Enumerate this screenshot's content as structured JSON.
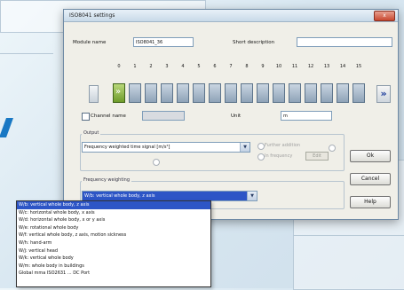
{
  "window": {
    "title": "ISO8041 settings",
    "close_symbol": "x"
  },
  "module": {
    "name_label": "Module name",
    "name_value": "ISO8041_36",
    "short_desc_label": "Short description",
    "short_desc_value": ""
  },
  "channels": {
    "numbers": [
      "0",
      "1",
      "2",
      "3",
      "4",
      "5",
      "6",
      "7",
      "8",
      "9",
      "10",
      "11",
      "12",
      "13",
      "14",
      "15"
    ],
    "active_index": 0,
    "nav_last_symbol": "»"
  },
  "channel_name": {
    "label": "Channel name",
    "value": "",
    "checked": false
  },
  "unit": {
    "label": "Unit",
    "value": "m"
  },
  "output": {
    "group_label": "Output",
    "selected": "Frequency weighted time signal [m/s²]",
    "option_a": "Further addition",
    "option_b": "In frequency",
    "small_button": "Edit"
  },
  "frequency_weighting": {
    "group_label": "Frequency weighting",
    "selected": "W/b: vertical whole body, z axis",
    "options": [
      "W/b: vertical whole body, z axis",
      "W/c: horizontal whole body, x axis",
      "W/d: horizontal whole body, x or y axis",
      "W/e: rotational whole body",
      "W/f: vertical whole body, z axis, motion sickness",
      "W/h: hand-arm",
      "W/j: vertical head",
      "W/k: vertical whole body",
      "W/m: whole body in buildings",
      "Global mma ISO2631 ... DC Port"
    ],
    "selected_index": 0
  },
  "buttons": {
    "ok": "Ok",
    "cancel": "Cancel",
    "help": "Help"
  },
  "icons": {
    "combo_arrow": "chevron-down-icon",
    "channel_forward": "double-chevron-right-icon"
  },
  "colors": {
    "selection": "#2d55c6",
    "channel_active": "#6e9b2a",
    "channel_idle": "#8fa3b8"
  }
}
